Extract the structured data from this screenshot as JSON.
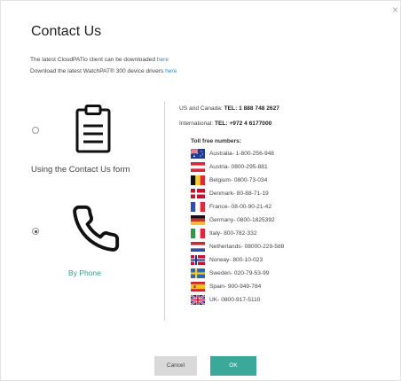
{
  "dialog": {
    "title": "Contact Us",
    "close_glyph": "×",
    "info": {
      "line1_text": "The latest CloudPATio client can be downloaded",
      "line1_link": "here",
      "line2_text": "Download the latest WatchPAT® 300 device drivers",
      "line2_link": "here"
    }
  },
  "options": [
    {
      "label": "Using the Contact Us form",
      "icon": "clipboard-icon",
      "selected": false
    },
    {
      "label": "By Phone",
      "icon": "phone-icon",
      "selected": true
    }
  ],
  "phone_info": {
    "us_prefix": "US and Canada:",
    "us_number": "TEL: 1 888 748 2627",
    "intl_prefix": "International:",
    "intl_number": "TEL: +972 4 6177000",
    "toll_free_heading": "Toll free numbers:",
    "countries": [
      {
        "text": "Australia- 1-800-256-948",
        "flag": "australia"
      },
      {
        "text": "Austria- 0800-295-881",
        "flag": "austria"
      },
      {
        "text": "Belgium- 0800-73-034",
        "flag": "belgium"
      },
      {
        "text": "Denmark- 80-88-71-19",
        "flag": "denmark"
      },
      {
        "text": "France- 08-00-90-21-42",
        "flag": "france"
      },
      {
        "text": "Germany- 0800-1825392",
        "flag": "germany"
      },
      {
        "text": "Italy- 800-782-332",
        "flag": "italy"
      },
      {
        "text": "Netherlands- 08000-229-588",
        "flag": "netherlands"
      },
      {
        "text": "Norway- 800-10-023",
        "flag": "norway"
      },
      {
        "text": "Sweden- 020-79-53-99",
        "flag": "sweden"
      },
      {
        "text": "Spain- 900-949-784",
        "flag": "spain"
      },
      {
        "text": "UK- 0800-917-5110",
        "flag": "uk"
      }
    ]
  },
  "buttons": {
    "cancel": "Cancel",
    "ok": "OK"
  },
  "colors": {
    "accent": "#3aa99a",
    "phone_label": "#2e9f86",
    "link": "#2f86d1"
  }
}
